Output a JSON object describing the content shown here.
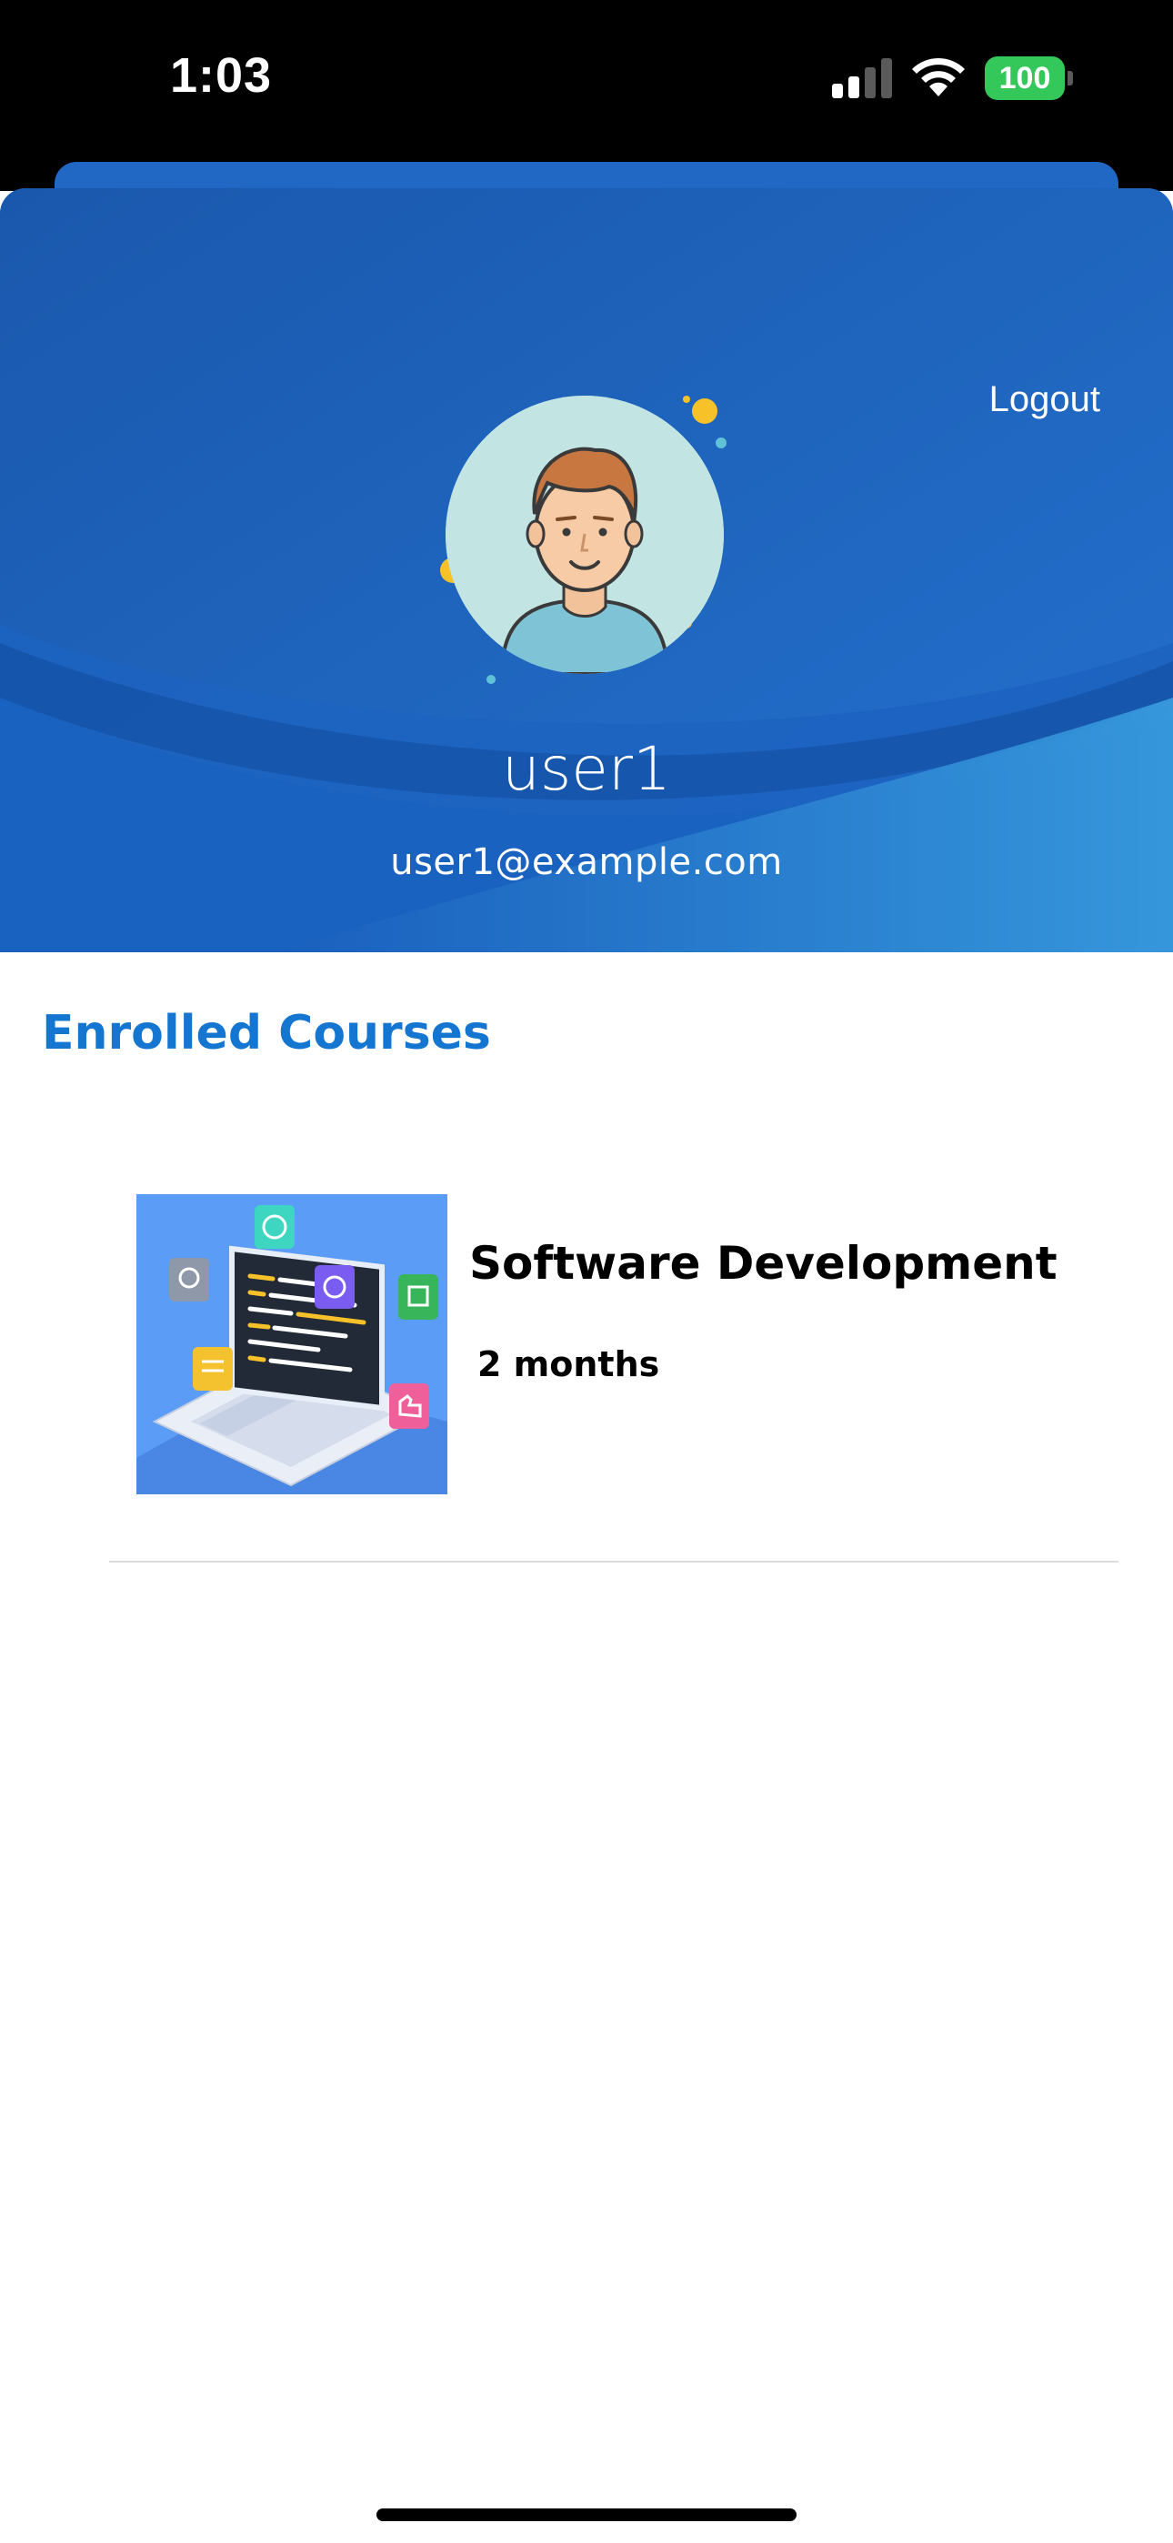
{
  "status_bar": {
    "time": "1:03",
    "battery_level": "100",
    "signal_bars": 2,
    "battery_color": "#34c759",
    "icons": [
      "signal-icon",
      "wifi-icon",
      "battery-icon"
    ]
  },
  "header": {
    "logout_label": "Logout",
    "avatar_icon": "user-avatar-illustration",
    "user_name": "user1",
    "user_email": "user1@example.com",
    "background_color": "#1e69c3"
  },
  "enrolled": {
    "section_title": "Enrolled Courses",
    "title_color": "#1576d1",
    "courses": [
      {
        "title": "Software Development",
        "duration": "2 months",
        "thumbnail_icon": "laptop-code-illustration"
      }
    ]
  }
}
